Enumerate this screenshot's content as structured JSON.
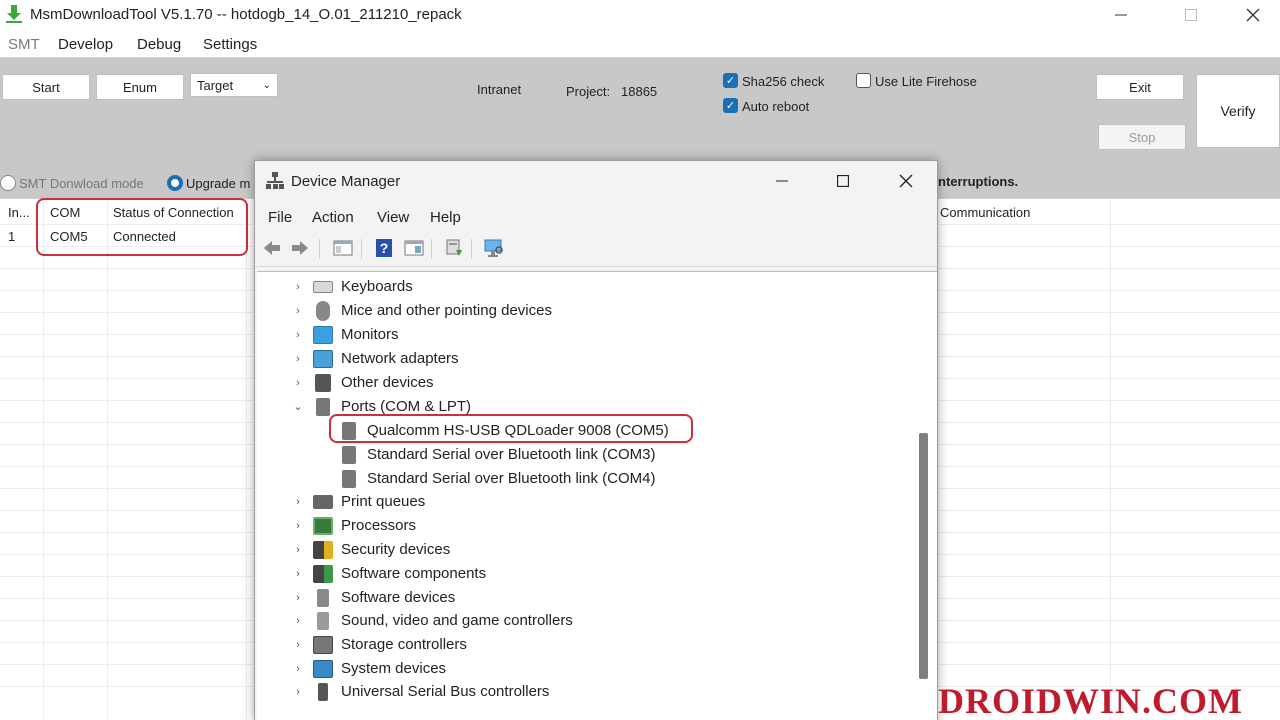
{
  "app": {
    "title": "MsmDownloadTool V5.1.70 -- hotdogb_14_O.01_211210_repack",
    "menu": [
      "SMT",
      "Develop",
      "Debug",
      "Settings"
    ],
    "buttons": {
      "start": "Start",
      "enum": "Enum",
      "target": "Target",
      "exit": "Exit",
      "stop": "Stop",
      "verify": "Verify"
    },
    "info": {
      "network": "Intranet",
      "project_label": "Project:",
      "project_value": "18865"
    },
    "checkboxes": [
      {
        "label": "Sha256 check",
        "checked": true
      },
      {
        "label": "Auto reboot",
        "checked": true
      },
      {
        "label": "Use Lite Firehose",
        "checked": false
      }
    ],
    "modes": [
      {
        "label": "SMT Donwload mode",
        "selected": false
      },
      {
        "label": "Upgrade m",
        "selected": true
      }
    ],
    "status_partial": "nterruptions.",
    "table": {
      "headers": [
        "In...",
        "COM",
        "Status of Connection"
      ],
      "rows": [
        [
          "1",
          "COM5",
          "Connected"
        ]
      ],
      "extra_header": "Communication"
    }
  },
  "device_manager": {
    "title": "Device Manager",
    "menu": [
      "File",
      "Action",
      "View",
      "Help"
    ],
    "tree": [
      {
        "label": "Keyboards",
        "expanded": false,
        "icon": "keyboard-icon"
      },
      {
        "label": "Mice and other pointing devices",
        "expanded": false,
        "icon": "mouse-icon"
      },
      {
        "label": "Monitors",
        "expanded": false,
        "icon": "monitor-icon"
      },
      {
        "label": "Network adapters",
        "expanded": false,
        "icon": "network-icon"
      },
      {
        "label": "Other devices",
        "expanded": false,
        "icon": "unknown-device-icon"
      },
      {
        "label": "Ports (COM & LPT)",
        "expanded": true,
        "icon": "port-icon",
        "children": [
          {
            "label": "Qualcomm HS-USB QDLoader 9008 (COM5)",
            "highlighted": true,
            "icon": "port-icon"
          },
          {
            "label": "Standard Serial over Bluetooth link (COM3)",
            "icon": "port-icon"
          },
          {
            "label": "Standard Serial over Bluetooth link (COM4)",
            "icon": "port-icon"
          }
        ]
      },
      {
        "label": "Print queues",
        "expanded": false,
        "icon": "printer-icon"
      },
      {
        "label": "Processors",
        "expanded": false,
        "icon": "cpu-icon"
      },
      {
        "label": "Security devices",
        "expanded": false,
        "icon": "security-icon"
      },
      {
        "label": "Software components",
        "expanded": false,
        "icon": "software-component-icon"
      },
      {
        "label": "Software devices",
        "expanded": false,
        "icon": "software-device-icon"
      },
      {
        "label": "Sound, video and game controllers",
        "expanded": false,
        "icon": "speaker-icon"
      },
      {
        "label": "Storage controllers",
        "expanded": false,
        "icon": "storage-icon"
      },
      {
        "label": "System devices",
        "expanded": false,
        "icon": "system-icon"
      },
      {
        "label": "Universal Serial Bus controllers",
        "expanded": false,
        "icon": "usb-icon"
      }
    ]
  },
  "watermark": "DROIDWIN.COM",
  "colors": {
    "accent": "#1a6fb5",
    "highlight": "#c8303a",
    "watermark": "#c01b2c",
    "toolbar_bg": "#c8c8c8"
  }
}
